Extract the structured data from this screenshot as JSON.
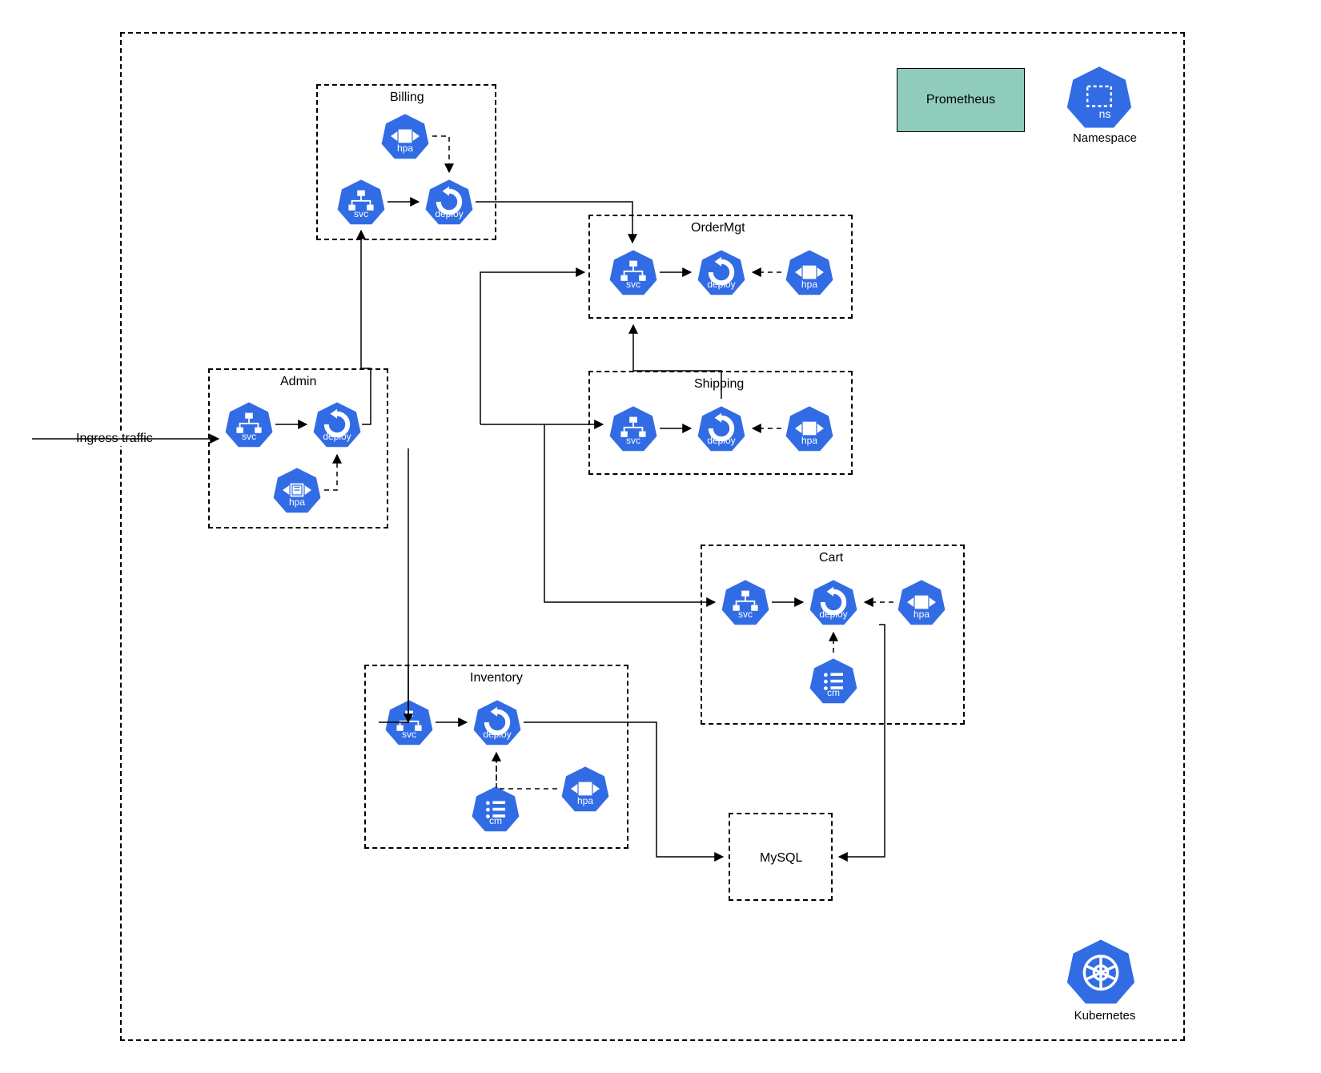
{
  "ingress_label": "Ingress traffic",
  "legend": {
    "prometheus": "Prometheus",
    "namespace": "Namespace",
    "kubernetes": "Kubernetes",
    "ns_icon_label": "ns"
  },
  "glyph": {
    "svc": "svc",
    "deploy": "deploy",
    "hpa": "hpa",
    "cm": "cm"
  },
  "services": {
    "admin": {
      "title": "Admin",
      "has": [
        "svc",
        "deploy",
        "hpa"
      ]
    },
    "billing": {
      "title": "Billing",
      "has": [
        "svc",
        "deploy",
        "hpa"
      ]
    },
    "ordermgt": {
      "title": "OrderMgt",
      "has": [
        "svc",
        "deploy",
        "hpa"
      ]
    },
    "shipping": {
      "title": "Shipping",
      "has": [
        "svc",
        "deploy",
        "hpa"
      ]
    },
    "cart": {
      "title": "Cart",
      "has": [
        "svc",
        "deploy",
        "hpa",
        "cm"
      ]
    },
    "inventory": {
      "title": "Inventory",
      "has": [
        "svc",
        "deploy",
        "hpa",
        "cm"
      ]
    },
    "mysql": {
      "title": "MySQL",
      "has": []
    }
  },
  "edges": [
    {
      "from": "ingress",
      "to": "admin.svc",
      "style": "solid"
    },
    {
      "from": "admin.svc",
      "to": "admin.deploy",
      "style": "solid"
    },
    {
      "from": "admin.hpa",
      "to": "admin.deploy",
      "style": "dashed"
    },
    {
      "from": "admin.deploy",
      "to": "billing.svc",
      "style": "solid"
    },
    {
      "from": "billing.svc",
      "to": "billing.deploy",
      "style": "solid"
    },
    {
      "from": "billing.hpa",
      "to": "billing.deploy",
      "style": "dashed"
    },
    {
      "from": "billing.deploy",
      "to": "ordermgt.svc",
      "style": "solid"
    },
    {
      "from": "ordermgt.svc",
      "to": "ordermgt.deploy",
      "style": "solid"
    },
    {
      "from": "ordermgt.hpa",
      "to": "ordermgt.deploy",
      "style": "dashed"
    },
    {
      "from": "admin.deploy",
      "to": "shipping.svc",
      "style": "solid"
    },
    {
      "from": "shipping.svc",
      "to": "shipping.deploy",
      "style": "solid"
    },
    {
      "from": "shipping.hpa",
      "to": "shipping.deploy",
      "style": "dashed"
    },
    {
      "from": "shipping.deploy",
      "to": "ordermgt.svc",
      "style": "solid"
    },
    {
      "from": "admin.deploy",
      "to": "cart.svc",
      "style": "solid"
    },
    {
      "from": "cart.svc",
      "to": "cart.deploy",
      "style": "solid"
    },
    {
      "from": "cart.hpa",
      "to": "cart.deploy",
      "style": "dashed"
    },
    {
      "from": "cart.cm",
      "to": "cart.deploy",
      "style": "dashed"
    },
    {
      "from": "cart.deploy",
      "to": "mysql",
      "style": "solid"
    },
    {
      "from": "admin.deploy",
      "to": "inventory.svc",
      "style": "solid"
    },
    {
      "from": "inventory.svc",
      "to": "inventory.deploy",
      "style": "solid"
    },
    {
      "from": "inventory.hpa",
      "to": "inventory.deploy",
      "style": "dashed"
    },
    {
      "from": "inventory.cm",
      "to": "inventory.deploy",
      "style": "dashed"
    },
    {
      "from": "inventory.deploy",
      "to": "mysql",
      "style": "solid"
    }
  ]
}
